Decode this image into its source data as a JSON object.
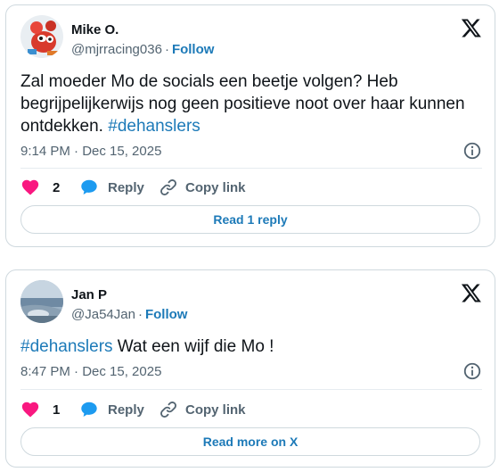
{
  "tweets": [
    {
      "name": "Mike O.",
      "handle": "@mjrracing036",
      "separator": "·",
      "follow_label": "Follow",
      "text_before": "Zal moeder Mo de socials een beetje volgen? Heb begrijpelijkerwijs nog geen positieve noot over haar kunnen ontdekken. ",
      "hashtag": "#dehanslers",
      "text_after": "",
      "timestamp": "9:14 PM · Dec 15, 2025",
      "likes": "2",
      "reply_label": "Reply",
      "copy_label": "Copy link",
      "footer_button": "Read 1 reply",
      "avatar_icon": "cartoon-crab-avatar",
      "like_color": "#f91880"
    },
    {
      "name": "Jan P",
      "handle": "@Ja54Jan",
      "separator": "·",
      "follow_label": "Follow",
      "text_before": "",
      "hashtag": "#dehanslers",
      "text_after": " Wat een wijf die Mo !",
      "timestamp": "8:47 PM · Dec 15, 2025",
      "likes": "1",
      "reply_label": "Reply",
      "copy_label": "Copy link",
      "footer_button": "Read more on X",
      "avatar_icon": "seaside-landscape-avatar",
      "like_color": "#f91880"
    }
  ],
  "colors": {
    "link": "#1d7ab8",
    "reply_icon": "#1d9bf0",
    "border": "#cfd9de",
    "muted_text": "#536471"
  }
}
